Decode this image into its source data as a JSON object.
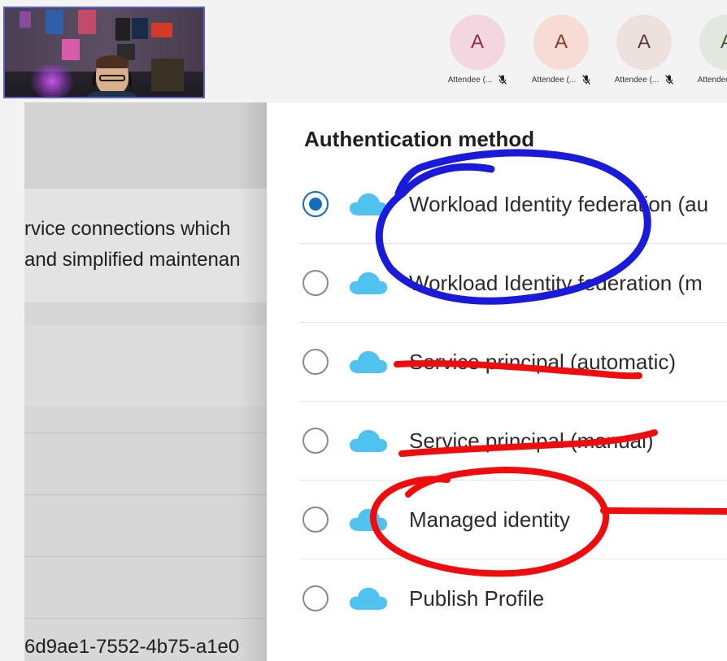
{
  "meeting": {
    "attendees": [
      {
        "initial": "A",
        "label": "Attendee (...",
        "bg": "#f2d7e0",
        "fg": "#8e2b4f",
        "mic_icon": "mic-off-icon"
      },
      {
        "initial": "A",
        "label": "Attendee (...",
        "bg": "#f7dcd6",
        "fg": "#8a3a2a",
        "mic_icon": "mic-off-icon"
      },
      {
        "initial": "A",
        "label": "Attendee (...",
        "bg": "#ece1dd",
        "fg": "#5a3f35",
        "mic_icon": "mic-off-icon"
      },
      {
        "initial": "A",
        "label": "Attendee (...",
        "bg": "#e3e8de",
        "fg": "#3d5a2e",
        "mic_icon": "mic-off-icon"
      }
    ]
  },
  "background_page": {
    "line1": "rvice connections which",
    "line2": "and simplified maintenan",
    "bottom_id": "6d9ae1-7552-4b75-a1e0"
  },
  "auth": {
    "title": "Authentication method",
    "options": [
      {
        "label": "Workload Identity federation (au",
        "selected": true,
        "icon": "azure-cloud-icon"
      },
      {
        "label": "Workload Identity federation (m",
        "selected": false,
        "icon": "azure-cloud-icon"
      },
      {
        "label": "Service principal (automatic)",
        "selected": false,
        "icon": "azure-cloud-icon"
      },
      {
        "label": "Service principal (manual)",
        "selected": false,
        "icon": "azure-cloud-icon"
      },
      {
        "label": "Managed identity",
        "selected": false,
        "icon": "azure-cloud-icon"
      },
      {
        "label": "Publish Profile",
        "selected": false,
        "icon": "azure-cloud-icon"
      }
    ]
  },
  "colors": {
    "accent": "#106ebe",
    "cloud": "#50c2f0",
    "annotation_blue": "#1a1adb",
    "annotation_red": "#f00c0c"
  }
}
